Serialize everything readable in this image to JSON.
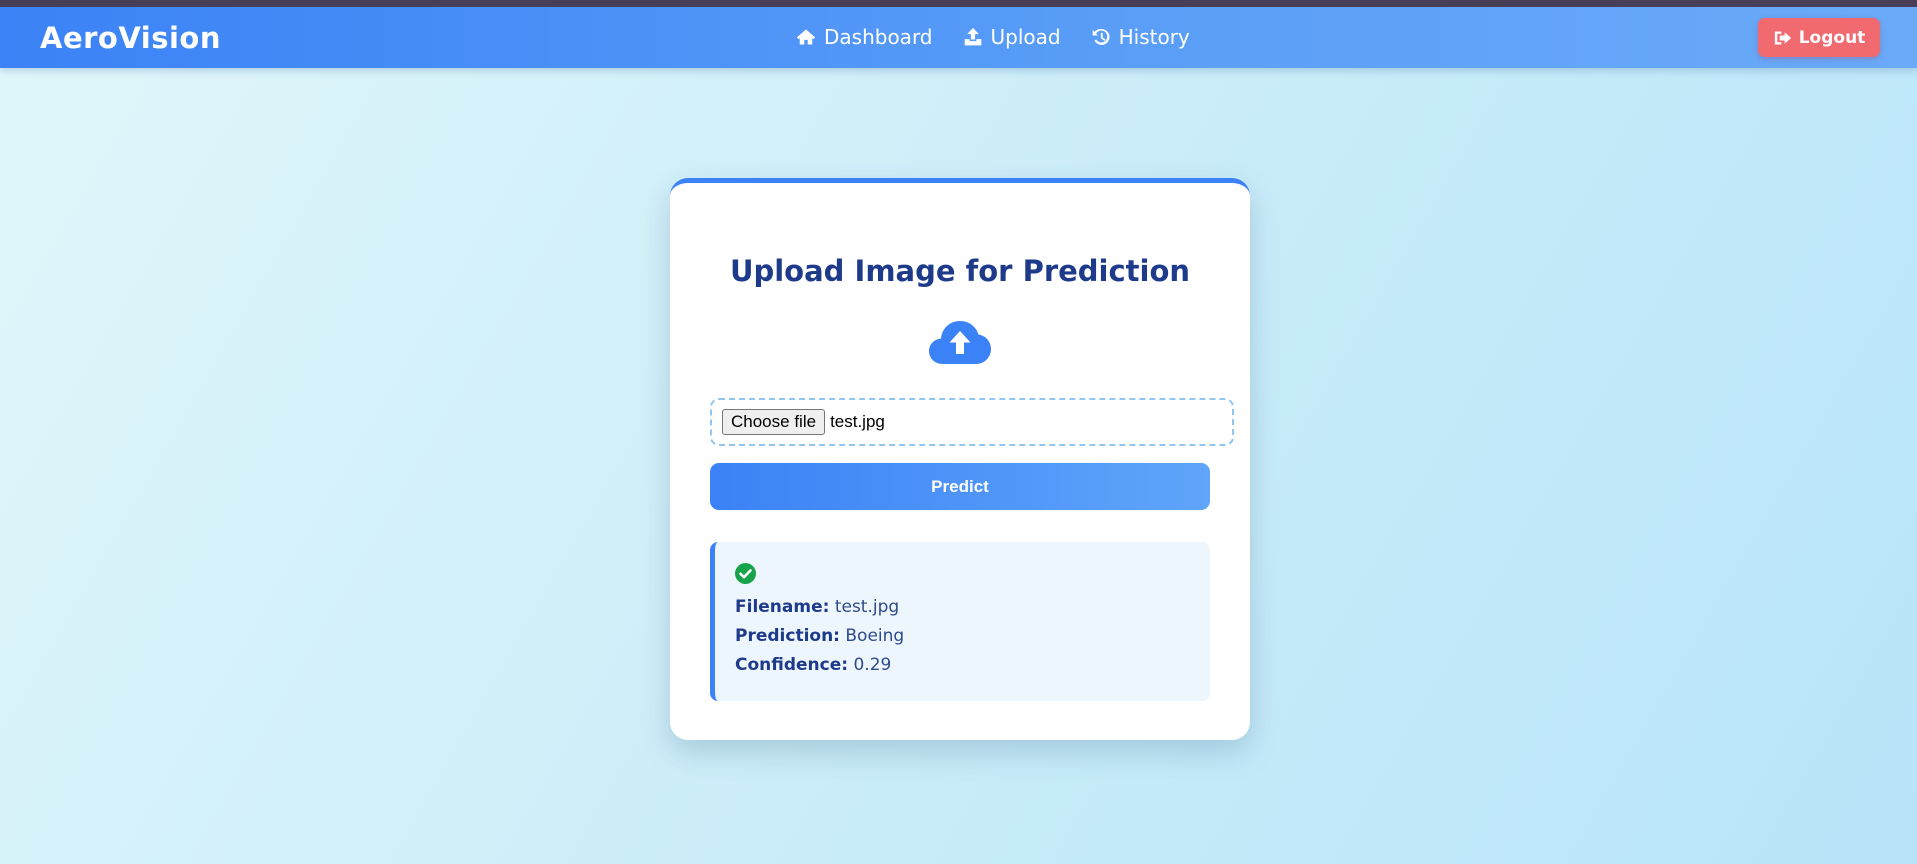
{
  "app": {
    "brand": "AeroVision"
  },
  "nav": {
    "items": [
      {
        "label": "Dashboard",
        "icon": "home-icon"
      },
      {
        "label": "Upload",
        "icon": "upload-icon"
      },
      {
        "label": "History",
        "icon": "history-icon"
      }
    ],
    "logout_label": "Logout"
  },
  "upload": {
    "title": "Upload Image for Prediction",
    "icon": "cloud-upload-icon",
    "choose_file_label": "Choose file",
    "selected_file": "test.jpg",
    "predict_label": "Predict"
  },
  "result": {
    "icon": "check-circle-icon",
    "filename_label": "Filename:",
    "filename_value": "test.jpg",
    "prediction_label": "Prediction:",
    "prediction_value": "Boeing",
    "confidence_label": "Confidence:",
    "confidence_value": "0.29"
  },
  "colors": {
    "primary": "#3b82f6",
    "logout": "#f06a6f",
    "title": "#1e3a8a",
    "success": "#16a34a"
  }
}
